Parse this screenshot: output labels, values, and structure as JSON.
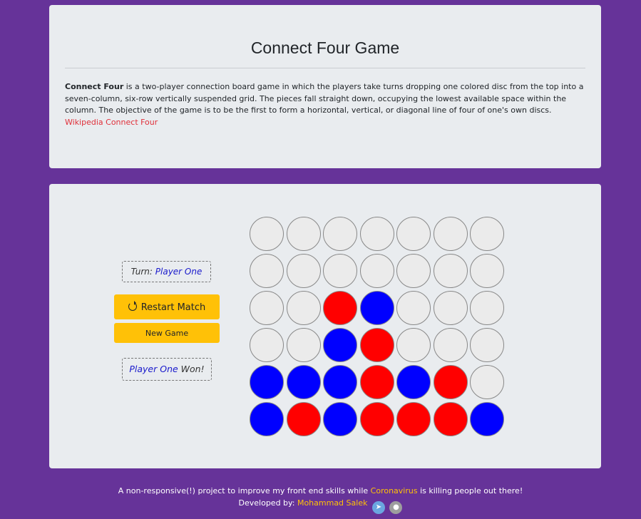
{
  "info": {
    "title": "Connect Four Game",
    "term": "Connect Four",
    "description": " is a two-player connection board game in which the players take turns dropping one colored disc from the top into a seven-column, six-row vertically suspended grid. The pieces fall straight down, occupying the lowest available space within the column. The objective of the game is to be the first to form a horizontal, vertical, or diagonal line of four of one's own discs.",
    "link_text": "Wikipedia Connect Four"
  },
  "game": {
    "turn_label": "Turn:",
    "turn_player": "Player One",
    "restart_label": "Restart Match",
    "new_game_label": "New Game",
    "winner_player": "Player One",
    "winner_suffix": "Won!",
    "colors": {
      "player_one": "#0000ff",
      "player_two": "#ff0000",
      "empty": "#ebebeb"
    },
    "board": [
      [
        "empty",
        "empty",
        "empty",
        "empty",
        "empty",
        "empty",
        "empty"
      ],
      [
        "empty",
        "empty",
        "empty",
        "empty",
        "empty",
        "empty",
        "empty"
      ],
      [
        "empty",
        "empty",
        "red",
        "blue",
        "empty",
        "empty",
        "empty"
      ],
      [
        "empty",
        "empty",
        "blue",
        "red",
        "empty",
        "empty",
        "empty"
      ],
      [
        "blue",
        "blue",
        "blue",
        "red",
        "blue",
        "red",
        "empty"
      ],
      [
        "blue",
        "red",
        "blue",
        "red",
        "red",
        "red",
        "blue"
      ]
    ]
  },
  "footer": {
    "line1_prefix": "A non-responsive(!) project to improve my front end skills while ",
    "line1_link": "Coronavirus",
    "line1_suffix": " is killing people out there!",
    "line2_prefix": "Developed by: ",
    "author": "Mohammad Salek",
    "icons": [
      "telegram-icon",
      "github-icon"
    ]
  }
}
